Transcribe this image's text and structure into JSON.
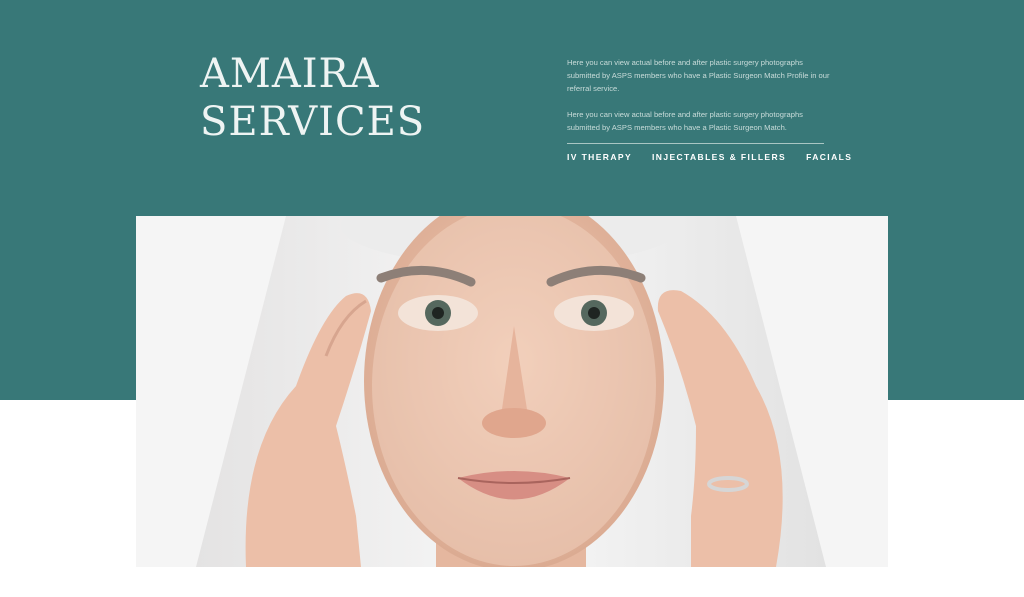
{
  "header": {
    "title_line1": "AMAIRA",
    "title_line2": "SERVICES",
    "intro_paragraph_1": "Here you can view actual before and after plastic surgery photographs submitted by ASPS members who have a Plastic Surgeon Match Profile in our referral service.",
    "intro_paragraph_2": "Here you can view actual before and after plastic surgery photographs submitted by ASPS members who have a Plastic Surgeon Match."
  },
  "nav": {
    "items": [
      {
        "label": "IV THERAPY"
      },
      {
        "label": "INJECTABLES & FILLERS"
      },
      {
        "label": "FACIALS"
      }
    ]
  },
  "colors": {
    "brand_teal": "#387878",
    "background": "#ffffff"
  }
}
